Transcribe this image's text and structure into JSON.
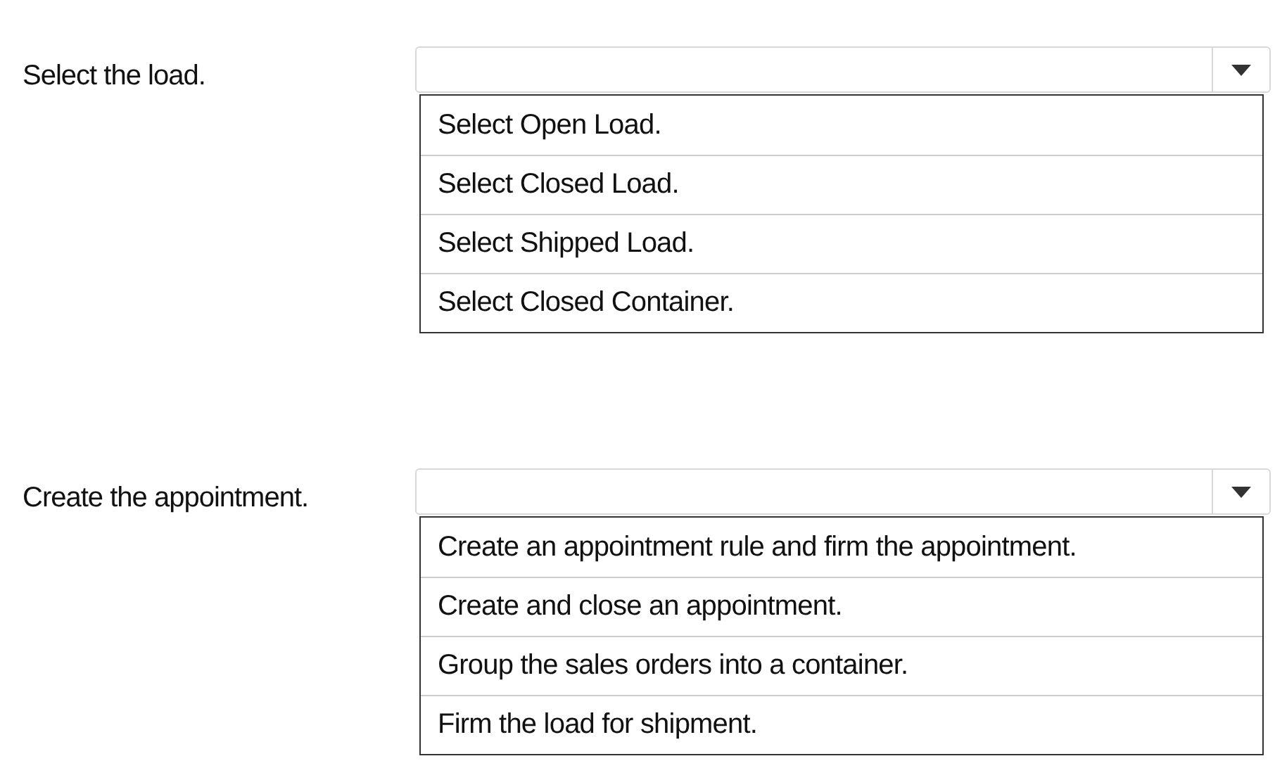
{
  "questions": [
    {
      "prompt": "Select the load.",
      "options": [
        "Select Open Load.",
        "Select Closed Load.",
        "Select Shipped Load.",
        "Select Closed Container."
      ]
    },
    {
      "prompt": "Create the appointment.",
      "options": [
        "Create an appointment rule and firm the appointment.",
        "Create and close an appointment.",
        "Group the sales orders into a container.",
        "Firm the load for shipment."
      ]
    }
  ]
}
